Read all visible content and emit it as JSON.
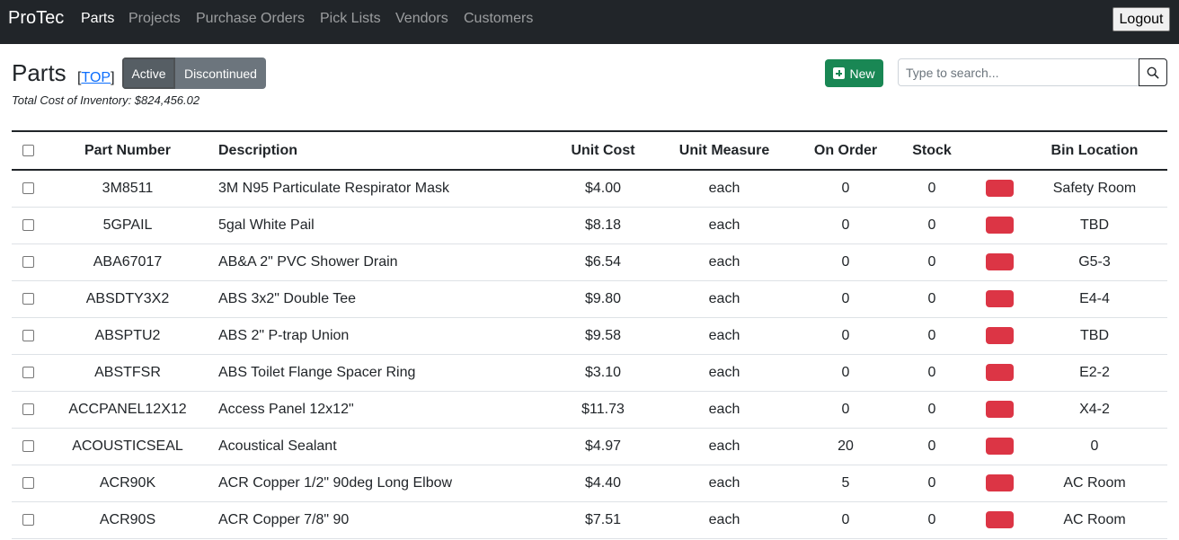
{
  "nav": {
    "brand": "ProTec",
    "links": [
      "Parts",
      "Projects",
      "Purchase Orders",
      "Pick Lists",
      "Vendors",
      "Customers"
    ],
    "logout": "Logout"
  },
  "header": {
    "title": "Parts",
    "top_bracket_open": "[",
    "top_link": "TOP",
    "top_bracket_close": "]",
    "filter_active": "Active",
    "filter_discontinued": "Discontinued",
    "total": "Total Cost of Inventory: $824,456.02",
    "new_label": "New",
    "search_placeholder": "Type to search..."
  },
  "colors": {
    "brand_green": "#198754",
    "stock_alert": "#dc3545",
    "navbar": "#212529"
  },
  "table": {
    "columns": [
      "Part Number",
      "Description",
      "Unit Cost",
      "Unit Measure",
      "On Order",
      "Stock",
      "",
      "Bin Location"
    ],
    "rows": [
      [
        "3M8511",
        "3M N95 Particulate Respirator Mask",
        "$4.00",
        "each",
        "0",
        "0",
        "Safety Room"
      ],
      [
        "5GPAIL",
        "5gal White Pail",
        "$8.18",
        "each",
        "0",
        "0",
        "TBD"
      ],
      [
        "ABA67017",
        "AB&A 2\" PVC Shower Drain",
        "$6.54",
        "each",
        "0",
        "0",
        "G5-3"
      ],
      [
        "ABSDTY3X2",
        "ABS 3x2\" Double Tee",
        "$9.80",
        "each",
        "0",
        "0",
        "E4-4"
      ],
      [
        "ABSPTU2",
        "ABS 2\" P-trap Union",
        "$9.58",
        "each",
        "0",
        "0",
        "TBD"
      ],
      [
        "ABSTFSR",
        "ABS Toilet Flange Spacer Ring",
        "$3.10",
        "each",
        "0",
        "0",
        "E2-2"
      ],
      [
        "ACCPANEL12X12",
        "Access Panel 12x12\"",
        "$11.73",
        "each",
        "0",
        "0",
        "X4-2"
      ],
      [
        "ACOUSTICSEAL",
        "Acoustical Sealant",
        "$4.97",
        "each",
        "20",
        "0",
        "0"
      ],
      [
        "ACR90K",
        "ACR Copper 1/2\" 90deg Long Elbow",
        "$4.40",
        "each",
        "5",
        "0",
        "AC Room"
      ],
      [
        "ACR90S",
        "ACR Copper 7/8\" 90",
        "$7.51",
        "each",
        "0",
        "0",
        "AC Room"
      ]
    ]
  }
}
